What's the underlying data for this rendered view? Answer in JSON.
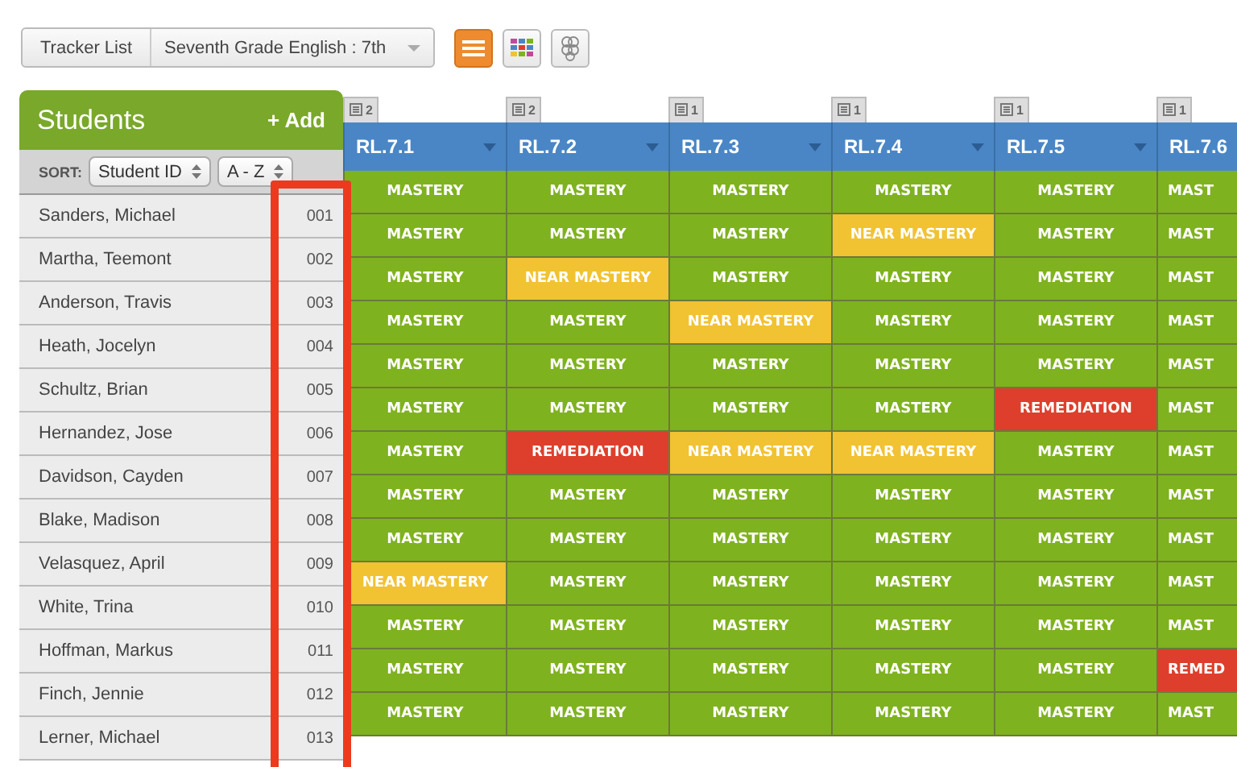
{
  "toolbar": {
    "tracker_button": "Tracker List",
    "class_select": "Seventh Grade English : 7th",
    "views": [
      {
        "kind": "list",
        "selected": true
      },
      {
        "kind": "grid",
        "selected": false
      },
      {
        "kind": "cluster",
        "selected": false
      }
    ]
  },
  "students": {
    "title": "Students",
    "add": "+ Add",
    "sort_label": "SORT:",
    "sort_field": "Student ID",
    "sort_order": "A - Z"
  },
  "columns": [
    {
      "name": "RL.7.1",
      "count": "2"
    },
    {
      "name": "RL.7.2",
      "count": "2"
    },
    {
      "name": "RL.7.3",
      "count": "1"
    },
    {
      "name": "RL.7.4",
      "count": "1"
    },
    {
      "name": "RL.7.5",
      "count": "1"
    },
    {
      "name": "RL.7.6",
      "count": "1"
    }
  ],
  "rows": [
    {
      "name": "Sanders, Michael",
      "id": "001",
      "cells": [
        {
          "kind": "mastery",
          "text": "MASTERY"
        },
        {
          "kind": "mastery",
          "text": "MASTERY"
        },
        {
          "kind": "mastery",
          "text": "MASTERY"
        },
        {
          "kind": "mastery",
          "text": "MASTERY"
        },
        {
          "kind": "mastery",
          "text": "MASTERY"
        },
        {
          "kind": "mastery",
          "text": "MAST"
        }
      ]
    },
    {
      "name": "Martha, Teemont",
      "id": "002",
      "cells": [
        {
          "kind": "mastery",
          "text": "MASTERY"
        },
        {
          "kind": "mastery",
          "text": "MASTERY"
        },
        {
          "kind": "mastery",
          "text": "MASTERY"
        },
        {
          "kind": "near",
          "text": "NEAR MASTERY"
        },
        {
          "kind": "mastery",
          "text": "MASTERY"
        },
        {
          "kind": "mastery",
          "text": "MAST"
        }
      ]
    },
    {
      "name": "Anderson, Travis",
      "id": "003",
      "cells": [
        {
          "kind": "mastery",
          "text": "MASTERY"
        },
        {
          "kind": "near",
          "text": "NEAR MASTERY"
        },
        {
          "kind": "mastery",
          "text": "MASTERY"
        },
        {
          "kind": "mastery",
          "text": "MASTERY"
        },
        {
          "kind": "mastery",
          "text": "MASTERY"
        },
        {
          "kind": "mastery",
          "text": "MAST"
        }
      ]
    },
    {
      "name": "Heath, Jocelyn",
      "id": "004",
      "cells": [
        {
          "kind": "mastery",
          "text": "MASTERY"
        },
        {
          "kind": "mastery",
          "text": "MASTERY"
        },
        {
          "kind": "near",
          "text": "NEAR MASTERY"
        },
        {
          "kind": "mastery",
          "text": "MASTERY"
        },
        {
          "kind": "mastery",
          "text": "MASTERY"
        },
        {
          "kind": "mastery",
          "text": "MAST"
        }
      ]
    },
    {
      "name": "Schultz, Brian",
      "id": "005",
      "cells": [
        {
          "kind": "mastery",
          "text": "MASTERY"
        },
        {
          "kind": "mastery",
          "text": "MASTERY"
        },
        {
          "kind": "mastery",
          "text": "MASTERY"
        },
        {
          "kind": "mastery",
          "text": "MASTERY"
        },
        {
          "kind": "mastery",
          "text": "MASTERY"
        },
        {
          "kind": "mastery",
          "text": "MAST"
        }
      ]
    },
    {
      "name": "Hernandez, Jose",
      "id": "006",
      "cells": [
        {
          "kind": "mastery",
          "text": "MASTERY"
        },
        {
          "kind": "mastery",
          "text": "MASTERY"
        },
        {
          "kind": "mastery",
          "text": "MASTERY"
        },
        {
          "kind": "mastery",
          "text": "MASTERY"
        },
        {
          "kind": "remediation",
          "text": "REMEDIATION"
        },
        {
          "kind": "mastery",
          "text": "MAST"
        }
      ]
    },
    {
      "name": "Davidson, Cayden",
      "id": "007",
      "cells": [
        {
          "kind": "mastery",
          "text": "MASTERY"
        },
        {
          "kind": "remediation",
          "text": "REMEDIATION"
        },
        {
          "kind": "near",
          "text": "NEAR MASTERY"
        },
        {
          "kind": "near",
          "text": "NEAR MASTERY"
        },
        {
          "kind": "mastery",
          "text": "MASTERY"
        },
        {
          "kind": "mastery",
          "text": "MAST"
        }
      ]
    },
    {
      "name": "Blake, Madison",
      "id": "008",
      "cells": [
        {
          "kind": "mastery",
          "text": "MASTERY"
        },
        {
          "kind": "mastery",
          "text": "MASTERY"
        },
        {
          "kind": "mastery",
          "text": "MASTERY"
        },
        {
          "kind": "mastery",
          "text": "MASTERY"
        },
        {
          "kind": "mastery",
          "text": "MASTERY"
        },
        {
          "kind": "mastery",
          "text": "MAST"
        }
      ]
    },
    {
      "name": "Velasquez, April",
      "id": "009",
      "cells": [
        {
          "kind": "mastery",
          "text": "MASTERY"
        },
        {
          "kind": "mastery",
          "text": "MASTERY"
        },
        {
          "kind": "mastery",
          "text": "MASTERY"
        },
        {
          "kind": "mastery",
          "text": "MASTERY"
        },
        {
          "kind": "mastery",
          "text": "MASTERY"
        },
        {
          "kind": "mastery",
          "text": "MAST"
        }
      ]
    },
    {
      "name": "White, Trina",
      "id": "010",
      "cells": [
        {
          "kind": "near",
          "text": "NEAR MASTERY"
        },
        {
          "kind": "mastery",
          "text": "MASTERY"
        },
        {
          "kind": "mastery",
          "text": "MASTERY"
        },
        {
          "kind": "mastery",
          "text": "MASTERY"
        },
        {
          "kind": "mastery",
          "text": "MASTERY"
        },
        {
          "kind": "mastery",
          "text": "MAST"
        }
      ]
    },
    {
      "name": "Hoffman, Markus",
      "id": "011",
      "cells": [
        {
          "kind": "mastery",
          "text": "MASTERY"
        },
        {
          "kind": "mastery",
          "text": "MASTERY"
        },
        {
          "kind": "mastery",
          "text": "MASTERY"
        },
        {
          "kind": "mastery",
          "text": "MASTERY"
        },
        {
          "kind": "mastery",
          "text": "MASTERY"
        },
        {
          "kind": "mastery",
          "text": "MAST"
        }
      ]
    },
    {
      "name": "Finch, Jennie",
      "id": "012",
      "cells": [
        {
          "kind": "mastery",
          "text": "MASTERY"
        },
        {
          "kind": "mastery",
          "text": "MASTERY"
        },
        {
          "kind": "mastery",
          "text": "MASTERY"
        },
        {
          "kind": "mastery",
          "text": "MASTERY"
        },
        {
          "kind": "mastery",
          "text": "MASTERY"
        },
        {
          "kind": "remediation",
          "text": "REMED"
        }
      ]
    },
    {
      "name": "Lerner, Michael",
      "id": "013",
      "cells": [
        {
          "kind": "mastery",
          "text": "MASTERY"
        },
        {
          "kind": "mastery",
          "text": "MASTERY"
        },
        {
          "kind": "mastery",
          "text": "MASTERY"
        },
        {
          "kind": "mastery",
          "text": "MASTERY"
        },
        {
          "kind": "mastery",
          "text": "MASTERY"
        },
        {
          "kind": "mastery",
          "text": "MAST"
        }
      ]
    }
  ]
}
